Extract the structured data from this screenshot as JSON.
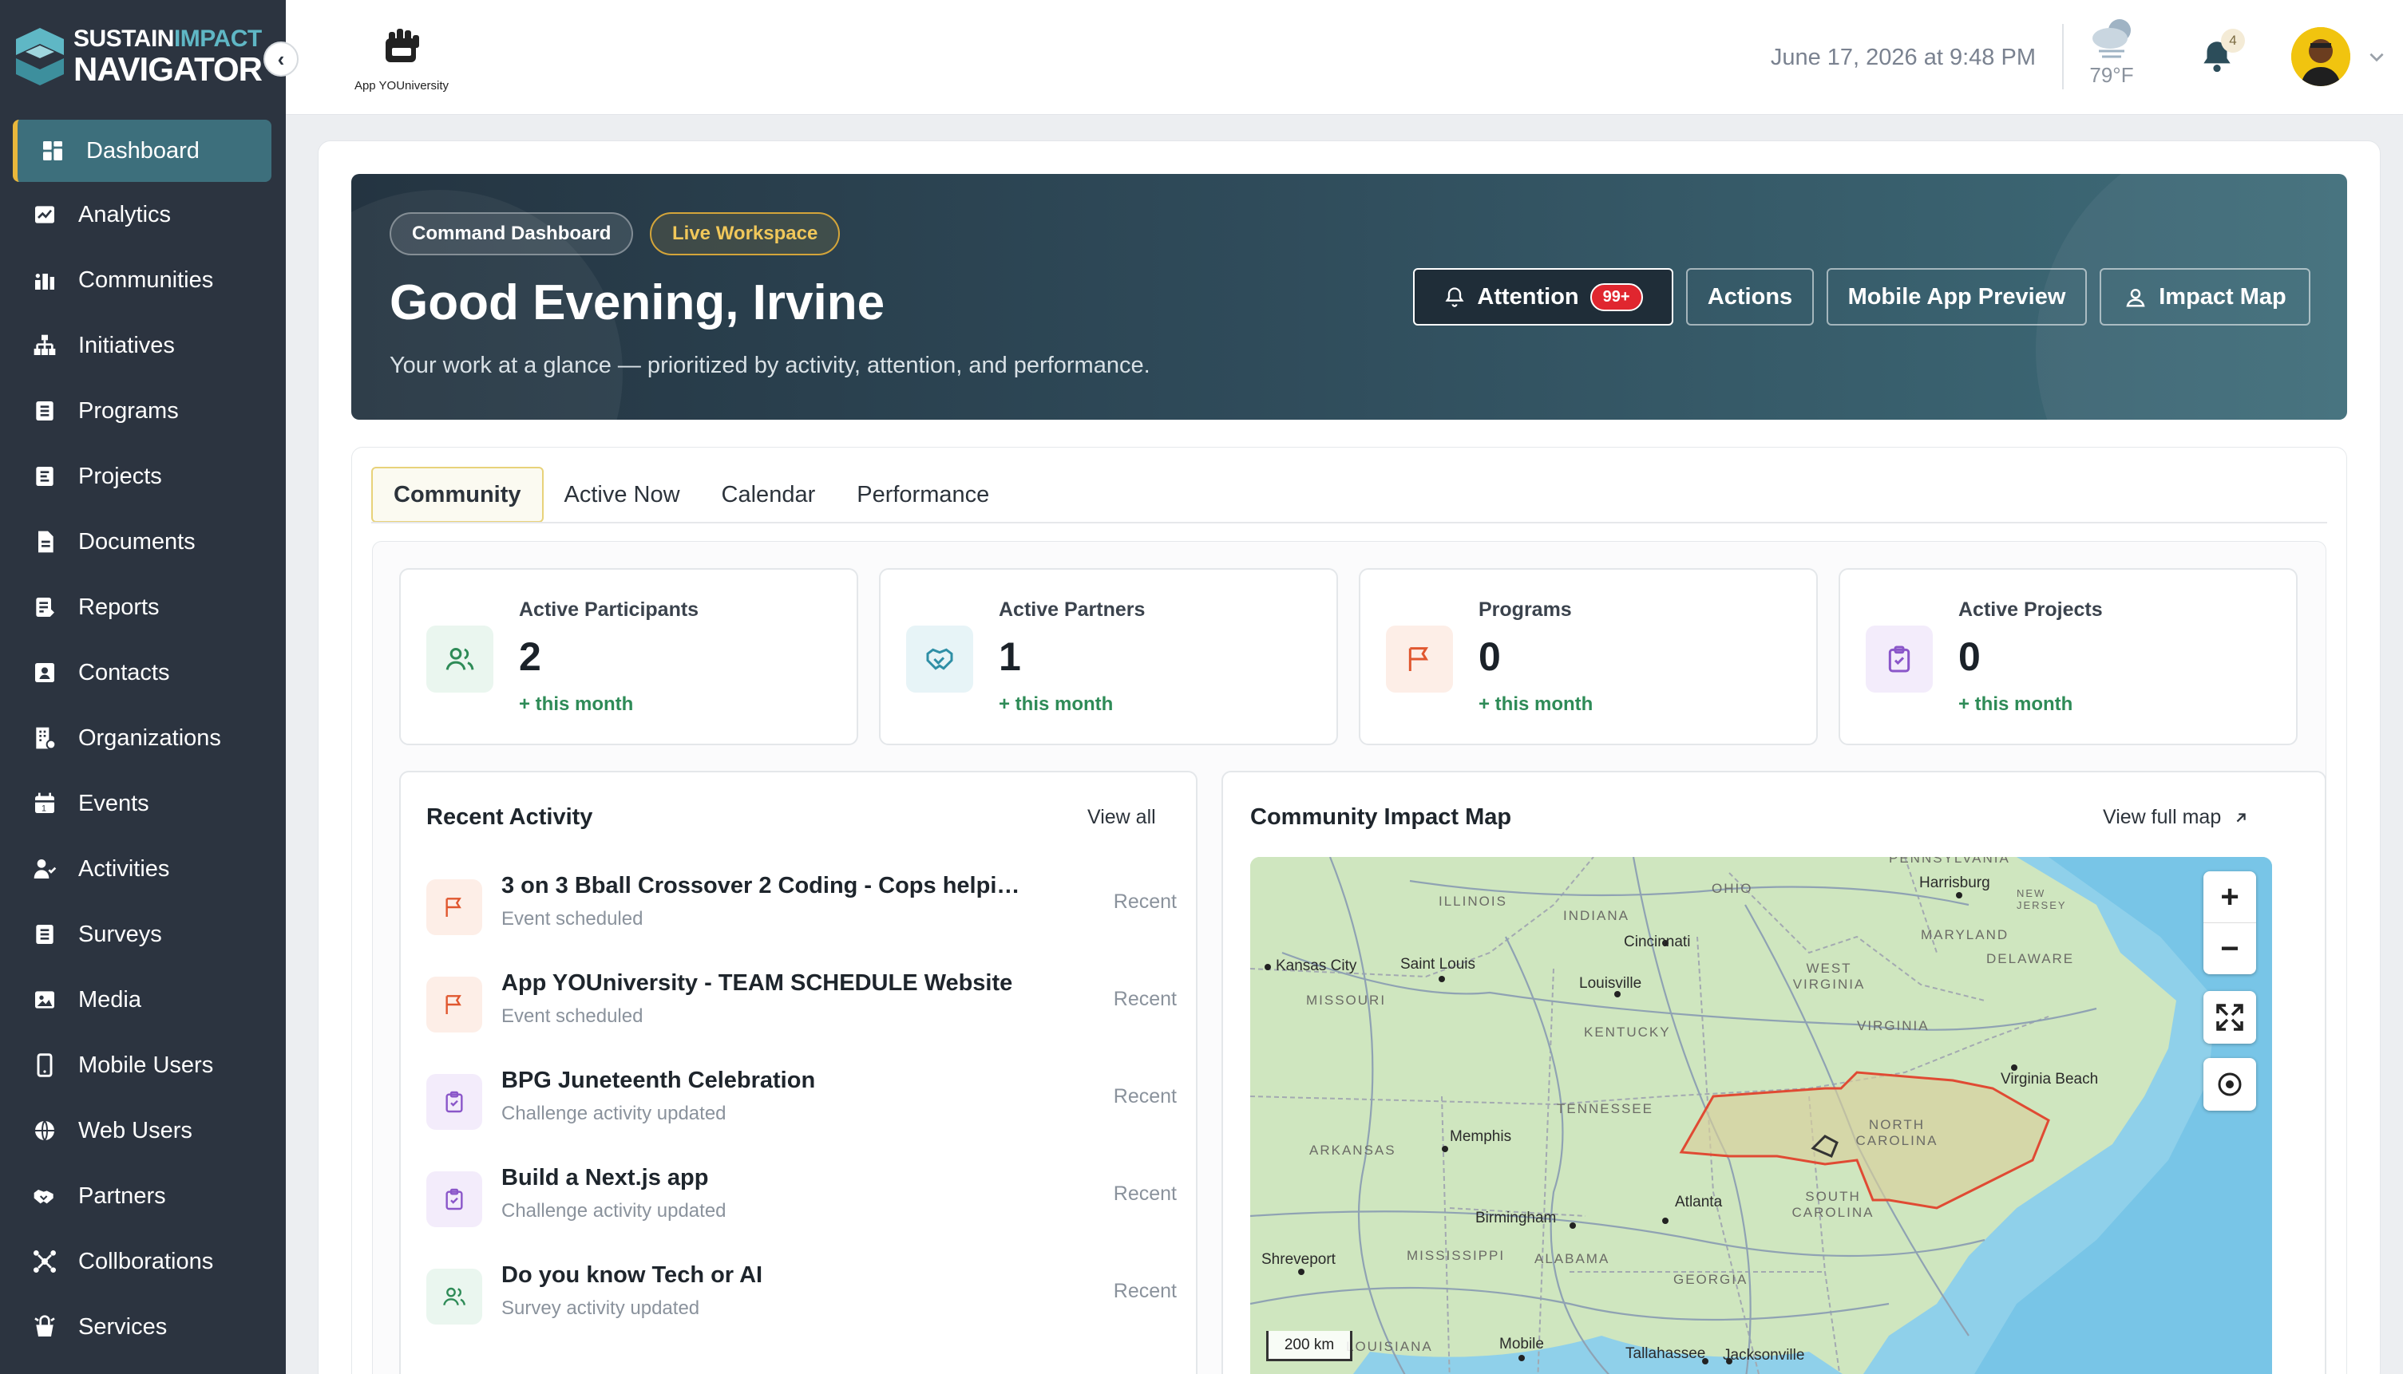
{
  "brand": {
    "line1_a": "SUSTAIN",
    "line1_b": "IMPACT",
    "line2": "NAVIGATOR"
  },
  "sidebar": {
    "items": [
      {
        "label": "Dashboard",
        "icon": "dashboard-icon",
        "active": true
      },
      {
        "label": "Analytics",
        "icon": "analytics-icon"
      },
      {
        "label": "Communities",
        "icon": "communities-icon"
      },
      {
        "label": "Initiatives",
        "icon": "initiatives-icon"
      },
      {
        "label": "Programs",
        "icon": "programs-icon"
      },
      {
        "label": "Projects",
        "icon": "projects-icon"
      },
      {
        "label": "Documents",
        "icon": "documents-icon"
      },
      {
        "label": "Reports",
        "icon": "reports-icon"
      },
      {
        "label": "Contacts",
        "icon": "contacts-icon"
      },
      {
        "label": "Organizations",
        "icon": "organizations-icon"
      },
      {
        "label": "Events",
        "icon": "events-icon"
      },
      {
        "label": "Activities",
        "icon": "activities-icon"
      },
      {
        "label": "Surveys",
        "icon": "surveys-icon"
      },
      {
        "label": "Media",
        "icon": "media-icon"
      },
      {
        "label": "Mobile Users",
        "icon": "mobile-icon"
      },
      {
        "label": "Web Users",
        "icon": "globe-icon"
      },
      {
        "label": "Partners",
        "icon": "handshake-icon"
      },
      {
        "label": "Collborations",
        "icon": "collaboration-icon"
      },
      {
        "label": "Services",
        "icon": "services-icon"
      }
    ]
  },
  "topbar": {
    "app_logo_text": "App YOUniversity",
    "datetime": "June 17, 2026 at 9:48 PM",
    "weather_temp": "79°F",
    "notifications_count": "4"
  },
  "hero": {
    "pill_command": "Command Dashboard",
    "pill_live": "Live Workspace",
    "title": "Good Evening, Irvine",
    "subtitle": "Your work at a glance — prioritized by activity, attention, and performance.",
    "btn_attention": "Attention",
    "attention_badge": "99+",
    "btn_actions": "Actions",
    "btn_mobile": "Mobile App Preview",
    "btn_map": "Impact Map"
  },
  "tabs": [
    "Community",
    "Active Now",
    "Calendar",
    "Performance"
  ],
  "stats": [
    {
      "label": "Active Participants",
      "value": "2",
      "delta": "+ this month",
      "color": "#2e8b57",
      "bg": "#eaf6ef",
      "icon": "users-icon"
    },
    {
      "label": "Active Partners",
      "value": "1",
      "delta": "+ this month",
      "color": "#2f8fa6",
      "bg": "#e7f4f7",
      "icon": "handshake-icon"
    },
    {
      "label": "Programs",
      "value": "0",
      "delta": "+ this month",
      "color": "#e0572f",
      "bg": "#fdeee7",
      "icon": "flag-icon"
    },
    {
      "label": "Active Projects",
      "value": "0",
      "delta": "+ this month",
      "color": "#8a56c9",
      "bg": "#f3ecfb",
      "icon": "clipboard-icon"
    }
  ],
  "activity": {
    "title": "Recent Activity",
    "view_all": "View all",
    "items": [
      {
        "title": "3 on 3 Bball Crossover 2 Coding - Cops helping…",
        "sub": "Event scheduled",
        "time": "Recent",
        "type": "flag"
      },
      {
        "title": "App YOUniversity - TEAM SCHEDULE Website",
        "sub": "Event scheduled",
        "time": "Recent",
        "type": "flag"
      },
      {
        "title": "BPG Juneteenth Celebration",
        "sub": "Challenge activity updated",
        "time": "Recent",
        "type": "clipboard"
      },
      {
        "title": "Build a Next.js app",
        "sub": "Challenge activity updated",
        "time": "Recent",
        "type": "clipboard"
      },
      {
        "title": "Do you know Tech or AI",
        "sub": "Survey activity updated",
        "time": "Recent",
        "type": "users"
      }
    ]
  },
  "map": {
    "title": "Community Impact Map",
    "view_full": "View full map",
    "scale": "200 km",
    "cities": [
      "Kansas City",
      "Saint Louis",
      "Cincinnati",
      "Louisville",
      "Harrisburg",
      "Virginia Beach",
      "Memphis",
      "Birmingham",
      "Atlanta",
      "Shreveport",
      "Mobile",
      "Tallahassee",
      "Jacksonville"
    ],
    "states": [
      "ILLINOIS",
      "INDIANA",
      "OHIO",
      "MISSOURI",
      "KENTUCKY",
      "WEST VIRGINIA",
      "VIRGINIA",
      "TENNESSEE",
      "NORTH CAROLINA",
      "SOUTH CAROLINA",
      "ARKANSAS",
      "MISSISSIPPI",
      "ALABAMA",
      "GEORGIA",
      "MARYLAND",
      "DELAWARE",
      "NEW JERSEY",
      "PENNSYLVANIA",
      "LOUISIANA"
    ]
  }
}
